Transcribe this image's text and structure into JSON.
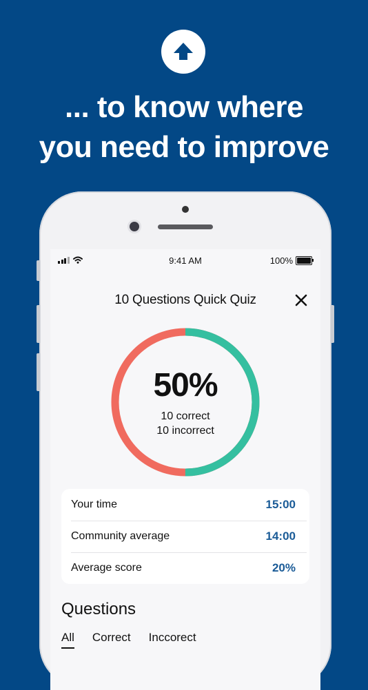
{
  "headline": {
    "line1": "... to know where",
    "line2": "you need to improve"
  },
  "icons": {
    "top": "arrow-up-icon",
    "signal": "signal-bars-icon",
    "wifi": "wifi-icon",
    "battery": "battery-icon",
    "close": "close-icon"
  },
  "status_bar": {
    "time": "9:41 AM",
    "battery": "100%"
  },
  "quiz": {
    "title": "10 Questions Quick Quiz",
    "score_percent": "50%",
    "correct_text": "10 correct",
    "incorrect_text": "10 incorrect",
    "correct_fraction": 0.5,
    "colors": {
      "correct": "#35bfa0",
      "incorrect": "#f06b5f"
    }
  },
  "stats": [
    {
      "label": "Your time",
      "value": "15:00"
    },
    {
      "label": "Community average",
      "value": "14:00"
    },
    {
      "label": "Average score",
      "value": "20%"
    }
  ],
  "questions": {
    "heading": "Questions",
    "tabs": [
      "All",
      "Correct",
      "Inccorect"
    ],
    "active_tab": "All"
  },
  "colors": {
    "background": "#034886",
    "stat_value": "#1a5b97"
  }
}
